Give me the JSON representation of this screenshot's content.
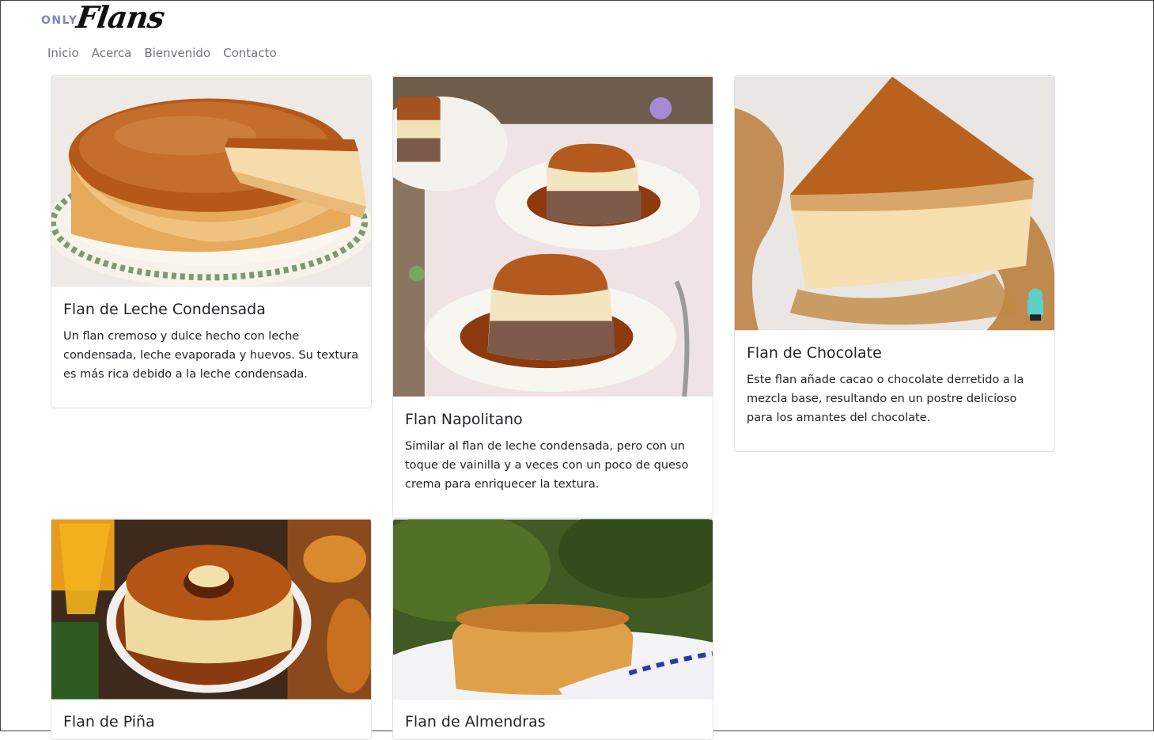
{
  "brand": {
    "prefix": "ONLY",
    "name": "Flans"
  },
  "nav": {
    "items": [
      "Inicio",
      "Acerca",
      "Bienvenido",
      "Contacto"
    ]
  },
  "cards": [
    {
      "title": "Flan de Leche Condensada",
      "text": "Un flan cremoso y dulce hecho con leche condensada, leche evaporada y huevos. Su textura es más rica debido a la leche condensada.",
      "image": "flan-leche-condensada-photo"
    },
    {
      "title": "Flan Napolitano",
      "text": "Similar al flan de leche condensada, pero con un toque de vainilla y a veces con un poco de queso crema para enriquecer la textura.",
      "image": "flan-napolitano-photo"
    },
    {
      "title": "Flan de Chocolate",
      "text": "Este flan añade cacao o chocolate derretido a la mezcla base, resultando en un postre delicioso para los amantes del chocolate.",
      "image": "flan-chocolate-photo"
    },
    {
      "title": "Flan de Piña",
      "text": "",
      "image": "flan-pina-photo"
    },
    {
      "title": "Flan de Almendras",
      "text": "",
      "image": "flan-almendras-photo"
    }
  ],
  "colors": {
    "caramel": "#a8531c",
    "custard": "#f2cf8c",
    "nav_text": "#6c757d",
    "brand_accent": "#7f87c6"
  }
}
